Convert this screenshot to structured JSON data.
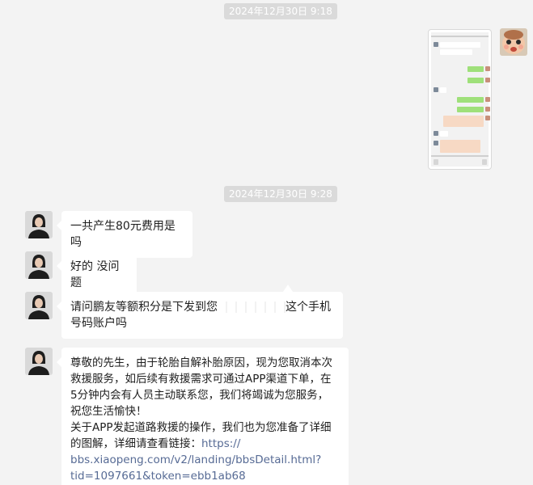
{
  "timestamps": {
    "first": "2024年12月30日 9:18",
    "second": "2024年12月30日 9:28"
  },
  "messages": {
    "m1": "一共产生80元费用是吗",
    "m2": "好的 没问题",
    "m3": {
      "before": "请问鹏友等额积分是下发到您",
      "after": "这个手机号码账户吗"
    },
    "m4": {
      "line1": "尊敬的先生，由于轮胎自解补胎原因，现为您取消本次",
      "line2": "救援服务，如后续有救援需求可通过APP渠道下单，在",
      "line3": "5分钟内会有人员主动联系您，我们将竭诚为您服务，",
      "line4": "祝您生活愉快！",
      "line5": "关于APP发起道路救援的操作，我们也为您准备了详细",
      "line6_text": "的图解，详细请查看链接：",
      "link_part1": "https://",
      "link_part2": "bbs.xiaopeng.com/v2/landing/bbsDetail.html?",
      "link_part3": "tid=1097661&token=ebb1ab68"
    }
  },
  "colors": {
    "background": "#f3f3f3",
    "bubble": "#ffffff",
    "timestamp_bg": "#dadada",
    "link": "#576b95"
  },
  "icons": {
    "sender_avatar": "avatar-woman-icon",
    "self_avatar": "avatar-baby-icon"
  }
}
